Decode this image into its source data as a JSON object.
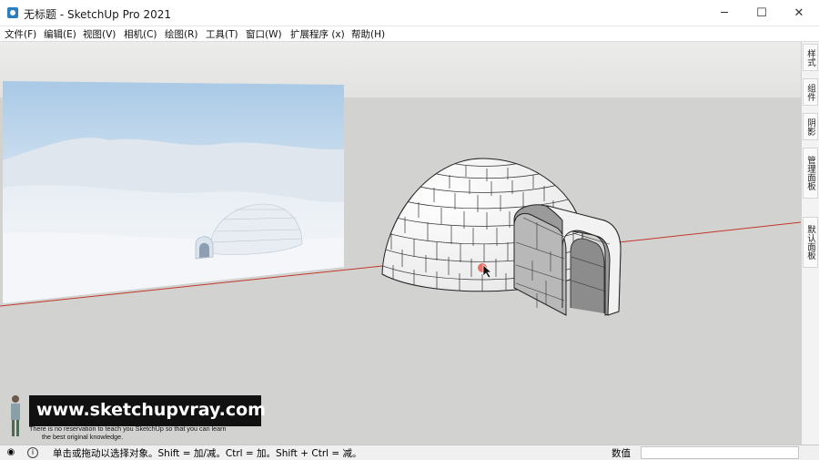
{
  "window": {
    "title": "无标题 - SketchUp Pro 2021",
    "controls": {
      "minimize": "─",
      "maximize": "☐",
      "close": "✕"
    }
  },
  "menu": [
    "文件(F)",
    "编辑(E)",
    "视图(V)",
    "相机(C)",
    "绘图(R)",
    "工具(T)",
    "窗口(W)",
    "扩展程序 (x)",
    "帮助(H)"
  ],
  "right_tabs": [
    "样式",
    "组件",
    "阴影",
    "管理面板",
    "默认面板"
  ],
  "status": {
    "hint": "单击或拖动以选择对象。Shift = 加/减。Ctrl = 加。Shift + Ctrl = 减。",
    "value_label": "数值",
    "value": ""
  },
  "watermark": {
    "url": "www.sketchupvray.com",
    "line1": "There is no reservation to teach you SketchUp so that you can learn",
    "line2": "the best original knowledge."
  },
  "colors": {
    "axis_red": "#c0392b",
    "viewport": "#d2d2d0",
    "app_icon": "#2a7fc1"
  }
}
